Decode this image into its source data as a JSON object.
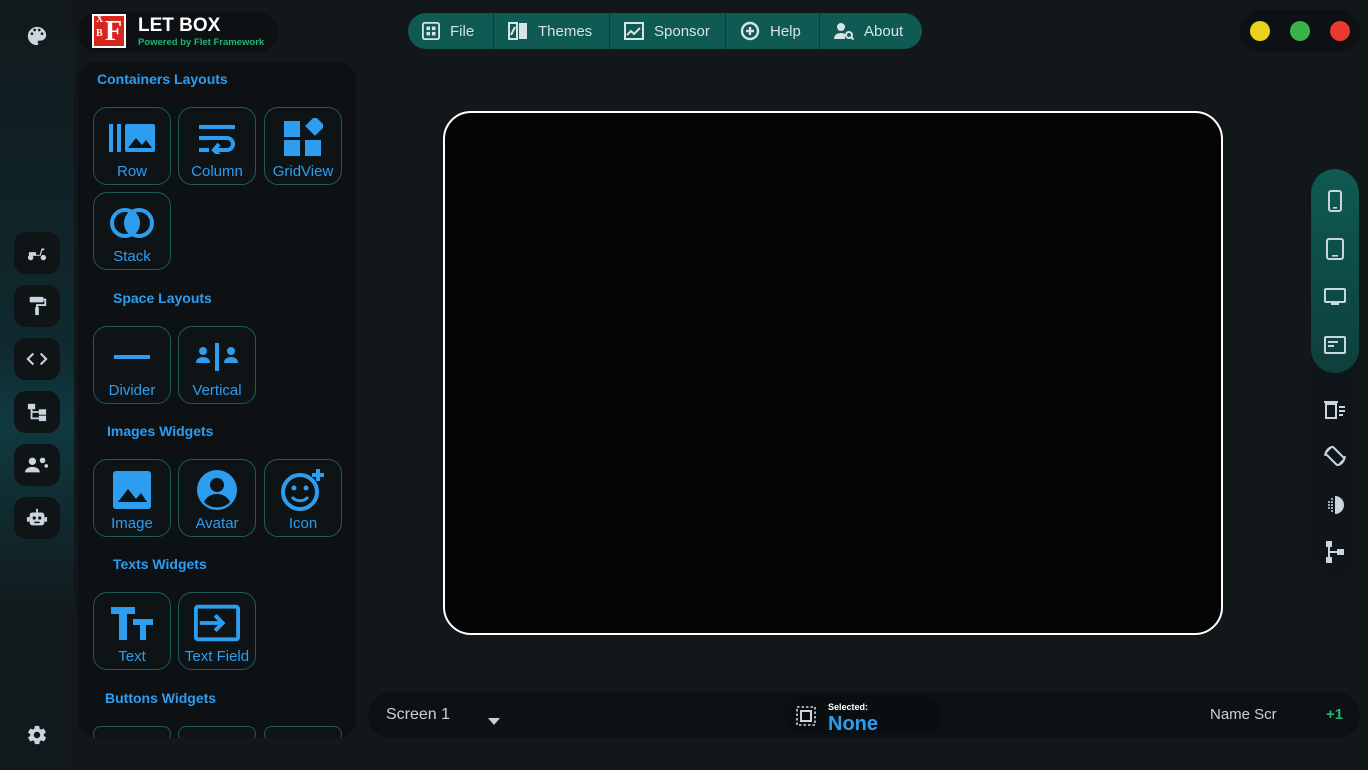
{
  "brand": {
    "title": "LET BOX",
    "subtitle": "Powered by Flet Framework",
    "logo_letters": {
      "big": "F",
      "small_top": "X",
      "small_bottom": "B"
    }
  },
  "menu": [
    {
      "label": "File",
      "icon": "grid-icon"
    },
    {
      "label": "Themes",
      "icon": "themes-icon"
    },
    {
      "label": "Sponsor",
      "icon": "chart-icon"
    },
    {
      "label": "Help",
      "icon": "help-icon"
    },
    {
      "label": "About",
      "icon": "about-icon"
    }
  ],
  "window_controls": {
    "colors": [
      "#e8d21a",
      "#3cb34a",
      "#ea3a30"
    ]
  },
  "rail": {
    "top_icon": "palette-icon",
    "items": [
      "scooter-icon",
      "paint-roller-icon",
      "code-icon",
      "tree-icon",
      "group-icon",
      "robot-icon"
    ],
    "bottom_icon": "settings-icon"
  },
  "panel": {
    "sections": [
      {
        "title": "Containers Layouts",
        "items": [
          "Row",
          "Column",
          "GridView",
          "Stack"
        ]
      },
      {
        "title": "Space Layouts",
        "items": [
          "Divider",
          "Vertical"
        ]
      },
      {
        "title": "Images Widgets",
        "items": [
          "Image",
          "Avatar",
          "Icon"
        ]
      },
      {
        "title": "Texts Widgets",
        "items": [
          "Text",
          "Text Field"
        ]
      },
      {
        "title": "Buttons Widgets",
        "items": []
      }
    ]
  },
  "right_toolbar": {
    "devices": [
      "phone-icon",
      "tablet-icon",
      "desktop-icon",
      "window-icon"
    ],
    "tools": [
      "delete-list-icon",
      "rotate-icon",
      "contrast-icon",
      "hierarchy-icon"
    ]
  },
  "bottom": {
    "screen_value": "Screen 1",
    "selected_label": "Selected:",
    "selected_value": "None",
    "name_placeholder": "Name Scr",
    "add_label": "+1"
  },
  "colors": {
    "accent": "#2d9df0",
    "teal": "#0f5a52",
    "brand_green": "#22b573"
  }
}
